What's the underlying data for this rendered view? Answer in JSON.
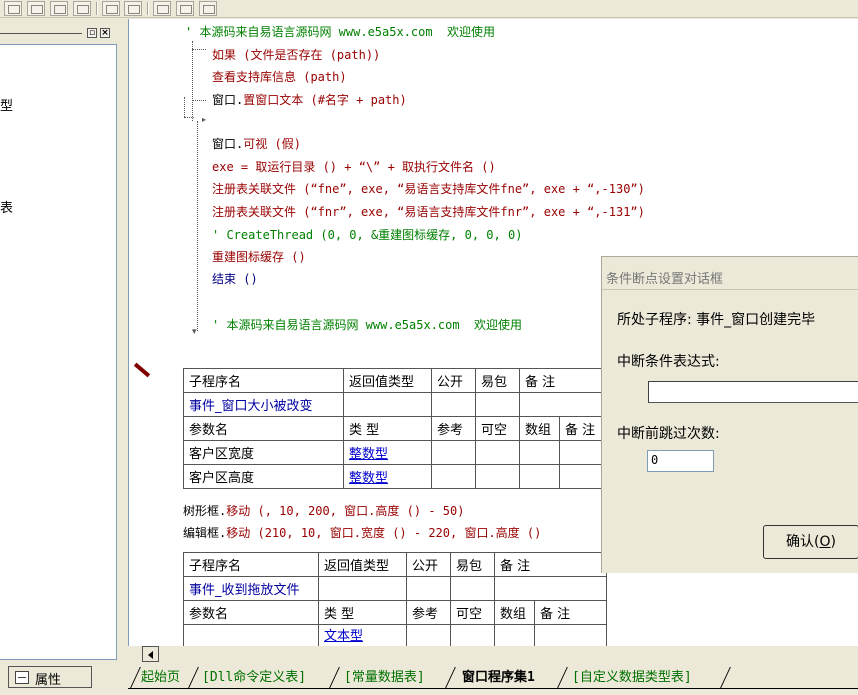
{
  "left_panel": {
    "tree_fragments": [
      "型",
      "表"
    ],
    "min_btn": "▫",
    "close_btn": "×",
    "props_tab": "属性"
  },
  "code": {
    "line1": "' 本源码来自易语言源码网 www.e5a5x.com  欢迎使用",
    "line2_kw": "如果",
    "line2_rest": " (文件是否存在 (path))",
    "line3": "查看支持库信息 (path)",
    "line4_a": "窗口.",
    "line4_kw": "置窗口文本",
    "line4_b": " (#名字 + path)",
    "line5_a": "窗口.",
    "line5_kw": "可视",
    "line5_b": " (假)",
    "line6": "exe = 取运行目录 () + “\\” + 取执行文件名 ()",
    "line7": "注册表关联文件 (“fne”, exe, “易语言支持库文件fne”, exe + “,-130”)",
    "line8": "注册表关联文件 (“fnr”, exe, “易语言支持库文件fnr”, exe + “,-131”)",
    "line9": "' CreateThread (0, 0, &重建图标缓存, 0, 0, 0)",
    "line10": "重建图标缓存 ()",
    "line11": "结束 ()",
    "line12": "' 本源码来自易语言源码网 www.e5a5x.com  欢迎使用",
    "line13_a": "树形框.",
    "line13_kw": "移动",
    "line13_b": " (, 10, 200, 窗口.",
    "line13_kw2": "高度",
    "line13_c": " () - 50)",
    "line14_a": "编辑框.",
    "line14_kw": "移动",
    "line14_b": " (210, 10, 窗口.",
    "line14_kw2": "宽度",
    "line14_c": " () - 220, 窗口.",
    "line14_kw3": "高度",
    "line14_d": " ()"
  },
  "table1": {
    "headers": [
      "子程序名",
      "返回值类型",
      "公开",
      "易包",
      "备 注"
    ],
    "name": "事件_窗口大小被改变",
    "param_headers": [
      "参数名",
      "类 型",
      "参考",
      "可空",
      "数组",
      "备 注"
    ],
    "params": [
      {
        "name": "客户区宽度",
        "type": "整数型"
      },
      {
        "name": "客户区高度",
        "type": "整数型"
      }
    ]
  },
  "table2": {
    "headers": [
      "子程序名",
      "返回值类型",
      "公开",
      "易包",
      "备 注"
    ],
    "name": "事件_收到拖放文件",
    "param_headers": [
      "参数名",
      "类 型",
      "参考",
      "可空",
      "数组",
      "备 注"
    ],
    "partial_type": "文本型"
  },
  "tabs": [
    "起始页",
    "[Dll命令定义表]",
    "[常量数据表]",
    "窗口程序集1",
    "[自定义数据类型表]"
  ],
  "dialog": {
    "title": "条件断点设置对话框",
    "sub_label": "所处子程序: 事件_窗口创建完毕",
    "cond_label": "中断条件表达式:",
    "skip_label": "中断前跳过次数:",
    "skip_value": "0",
    "ok_prefix": "确认(",
    "ok_key": "O",
    "ok_suffix": ")"
  }
}
